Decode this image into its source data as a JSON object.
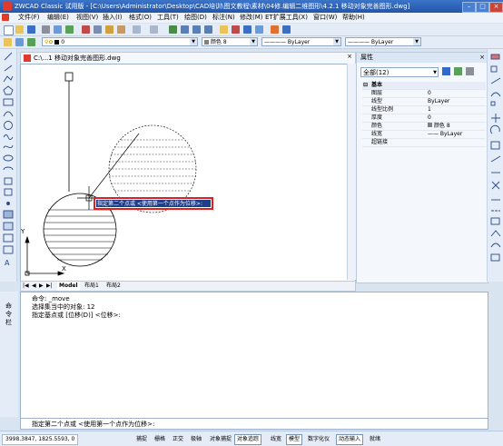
{
  "window": {
    "title": "ZWCAD Classic 试用版 - [C:\\Users\\Administrator\\Desktop\\CAD培训\\图文教程\\素材\\04修.编辑二维图形\\4.2.1 移动对象完善图形.dwg]"
  },
  "menu": [
    "文件(F)",
    "编辑(E)",
    "视图(V)",
    "插入(I)",
    "格式(O)",
    "工具(T)",
    "绘图(D)",
    "标注(N)",
    "修改(M)",
    "ET扩展工具(X)",
    "窗口(W)",
    "帮助(H)"
  ],
  "toolbar": {
    "layer_value": "0",
    "color_value": "颜色 8",
    "linetype_value": "ByLayer",
    "lineweight_value": "ByLayer"
  },
  "document": {
    "tab_title": "C:\\...1 移动对象完善图形.dwg"
  },
  "canvas": {
    "tooltip": "指定第二个点或 <使用第一个点作为位移>:",
    "ucs_x": "X",
    "ucs_y": "Y"
  },
  "layout_tabs": [
    "Model",
    "布局1",
    "布局2"
  ],
  "properties": {
    "panel_title": "属性",
    "selection": "全部(12)",
    "group": "基本",
    "rows": [
      {
        "key": "图层",
        "value": "0"
      },
      {
        "key": "线型",
        "value": "ByLayer"
      },
      {
        "key": "线型比例",
        "value": "1"
      },
      {
        "key": "厚度",
        "value": "0"
      },
      {
        "key": "颜色",
        "value": "颜色 8"
      },
      {
        "key": "线宽",
        "value": "—— ByLayer"
      },
      {
        "key": "超链接",
        "value": ""
      }
    ]
  },
  "command": {
    "side_label": "命令栏",
    "history": [
      "命令: _move",
      "选择集当中的对象: 12",
      "指定基点或 [位移(D)] <位移>:"
    ],
    "prompt": "指定第二个点或 <使用第一个点作为位移>:"
  },
  "status": {
    "coords": "3998.3847, 1825.5593, 0",
    "buttons": [
      "捕捉",
      "栅格",
      "正交",
      "极轴",
      "对象捕捉",
      "对象追踪",
      "线宽",
      "模型",
      "数字化仪",
      "动态输入",
      "就绪"
    ],
    "active": [
      "对象追踪",
      "模型",
      "动态输入"
    ]
  }
}
